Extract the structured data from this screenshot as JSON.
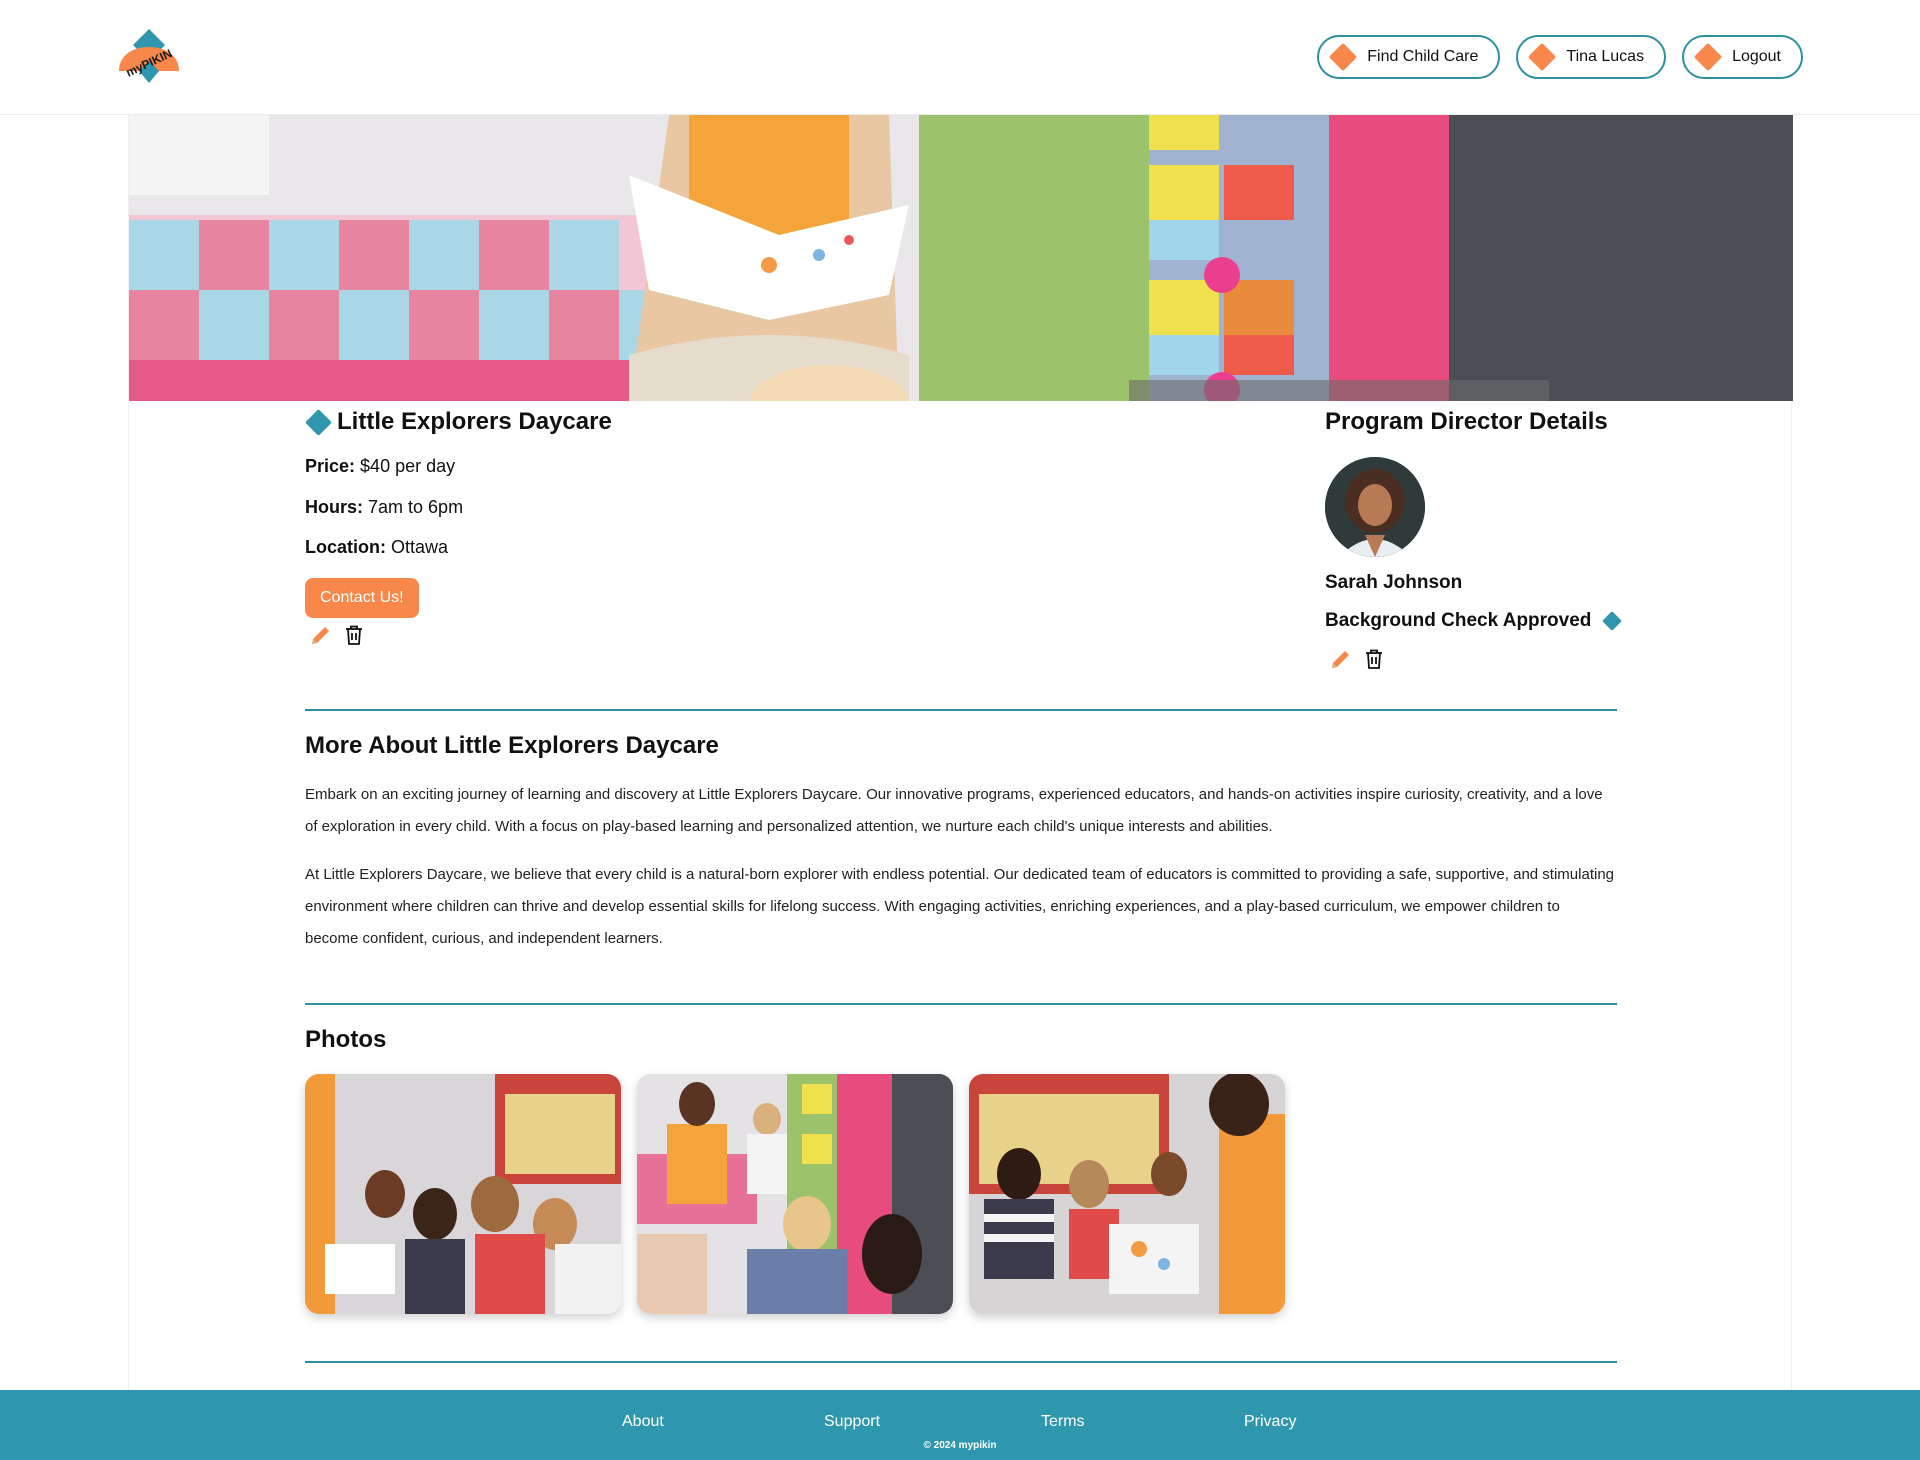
{
  "brand": {
    "logo_text": "myPIKIN"
  },
  "nav": {
    "find_child_care": "Find Child Care",
    "user_name": "Tina Lucas",
    "logout": "Logout"
  },
  "daycare": {
    "name": "Little Explorers Daycare",
    "price_label": "Price:",
    "price_value": "$40 per day",
    "hours_label": "Hours:",
    "hours_value": "7am to 6pm",
    "location_label": "Location:",
    "location_value": "Ottawa",
    "contact_button": "Contact Us!"
  },
  "director": {
    "heading": "Program Director Details",
    "name": "Sarah Johnson",
    "background_check": "Background Check Approved"
  },
  "about": {
    "heading": "More About Little Explorers Daycare",
    "paragraph_1": "Embark on an exciting journey of learning and discovery at Little Explorers Daycare. Our innovative programs, experienced educators, and hands-on activities inspire curiosity, creativity, and a love of exploration in every child. With a focus on play-based learning and personalized attention, we nurture each child's unique interests and abilities.",
    "paragraph_2": "At Little Explorers Daycare, we believe that every child is a natural-born explorer with endless potential. Our dedicated team of educators is committed to providing a safe, supportive, and stimulating environment where children can thrive and develop essential skills for lifelong success. With engaging activities, enriching experiences, and a play-based curriculum, we empower children to become confident, curious, and independent learners."
  },
  "photos": {
    "heading": "Photos"
  },
  "footer": {
    "about": "About",
    "support": "Support",
    "terms": "Terms",
    "privacy": "Privacy",
    "copyright": "© 2024 mypikin"
  },
  "colors": {
    "accent_orange": "#f7874a",
    "accent_teal": "#2e97ad",
    "border_teal": "#2e8f9e"
  },
  "icons": {
    "edit": "pencil-icon",
    "delete": "trash-icon",
    "bullet": "diamond-icon"
  }
}
